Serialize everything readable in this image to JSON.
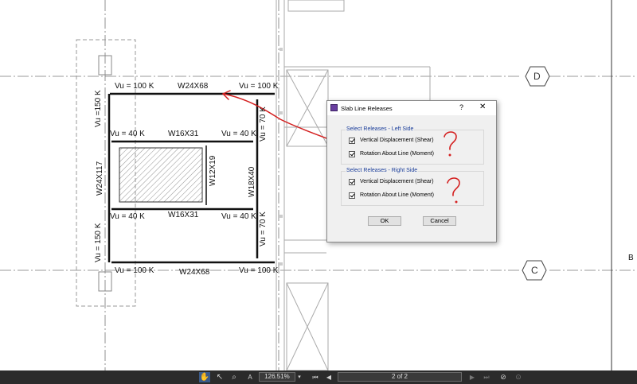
{
  "drawing": {
    "grid_bubbles": {
      "d": "D",
      "c": "C"
    },
    "side_label": "B",
    "beams": {
      "top": "W24X68",
      "bottom": "W24X68",
      "upper_inner": "W16X31",
      "lower_inner": "W16X31",
      "left": "W24X117",
      "right": "W18X40",
      "opening_right": "W12X19"
    },
    "loads": {
      "top_left": "Vu = 100 K",
      "top_right": "Vu = 100 K",
      "upper_inner_left": "Vu = 40 K",
      "upper_inner_right": "Vu = 40 K",
      "lower_inner_left": "Vu = 40 K",
      "lower_inner_right": "Vu = 40 K",
      "bottom_left": "Vu = 100 K",
      "bottom_right": "Vu = 100 K",
      "left_upper": "Vu =150 K",
      "left_lower": "Vu = 150 K",
      "right_upper": "Vu = 70 K",
      "right_lower": "Vu = 70 K"
    }
  },
  "dialog": {
    "title": "Slab Line Releases",
    "help_glyph": "?",
    "close_glyph": "✕",
    "left_group_title": "Select Releases - Left Side",
    "right_group_title": "Select Releases - Right Side",
    "left_options": [
      {
        "label": "Vertical Displacement (Shear)",
        "checked": true
      },
      {
        "label": "Rotation About Line (Moment)",
        "checked": true
      }
    ],
    "right_options": [
      {
        "label": "Vertical Displacement (Shear)",
        "checked": true
      },
      {
        "label": "Rotation About Line (Moment)",
        "checked": true
      }
    ],
    "ok_label": "OK",
    "cancel_label": "Cancel"
  },
  "annotations": {
    "question_mark": "?",
    "color": "#d42020"
  },
  "toolbar": {
    "zoom": "126.51%",
    "page_indicator": "2 of 2",
    "text_select_glyph": "A"
  }
}
